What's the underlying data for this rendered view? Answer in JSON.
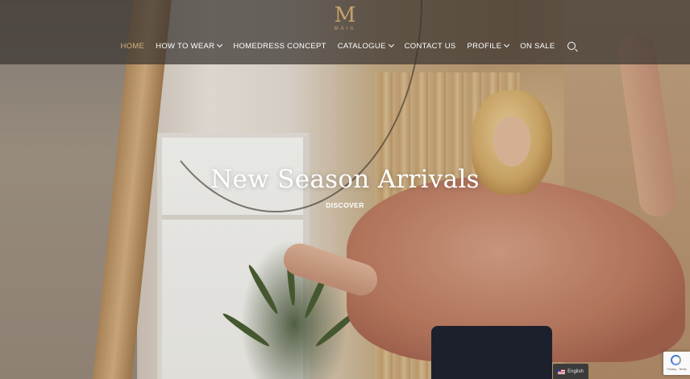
{
  "brand": {
    "logo_letter": "M",
    "logo_text": "MAIA",
    "color": "#c7a26b"
  },
  "nav": {
    "items": [
      {
        "label": "HOME",
        "active": true
      },
      {
        "label": "HOW TO WEAR",
        "dropdown": true
      },
      {
        "label": "HOMEDRESS CONCEPT"
      },
      {
        "label": "CATALOGUE",
        "dropdown": true
      },
      {
        "label": "CONTACT US"
      },
      {
        "label": "PROFILE",
        "dropdown": true
      },
      {
        "label": "ON SALE"
      }
    ],
    "search_icon": "search-icon",
    "active_color": "#d3b27e"
  },
  "hero": {
    "title": "New Season Arrivals",
    "cta": "DISCOVER"
  },
  "recaptcha": {
    "text": "Privacy - Terms"
  },
  "language": {
    "label": "English",
    "flag": "us-flag-icon"
  }
}
